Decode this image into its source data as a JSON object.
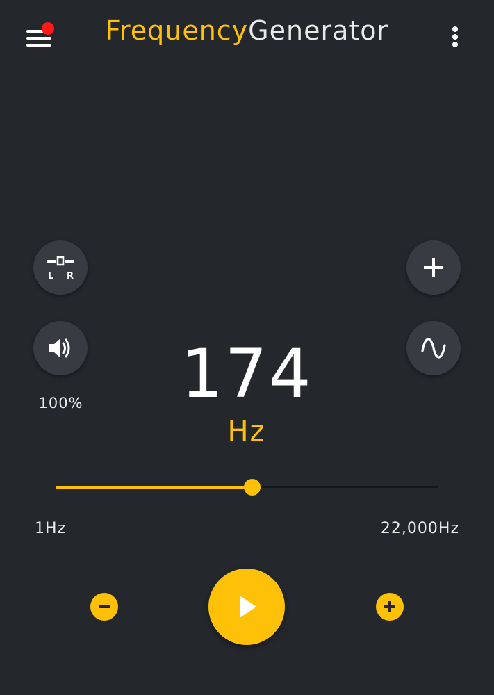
{
  "header": {
    "title_part1": "Frequency",
    "title_part2": "Generator",
    "menu_icon": "hamburger-menu-icon",
    "notification_color": "#ff1a1a",
    "more_icon": "more-vert-icon"
  },
  "controls": {
    "balance_icon": "balance-lr-icon",
    "balance_left": "L",
    "balance_right": "R",
    "volume_icon": "speaker-icon",
    "volume_percent": "100%",
    "add_icon": "plus-icon",
    "waveform_icon": "sine-wave-icon"
  },
  "frequency": {
    "value": "174",
    "unit": "Hz"
  },
  "slider": {
    "min_label": "1Hz",
    "max_label": "22,000Hz",
    "position_fraction": 0.515
  },
  "bottom": {
    "decrease_icon": "minus-circle-icon",
    "play_icon": "play-icon",
    "increase_icon": "plus-circle-icon"
  },
  "colors": {
    "accent": "#ffc107",
    "background": "#24272c",
    "button": "#383c42"
  }
}
